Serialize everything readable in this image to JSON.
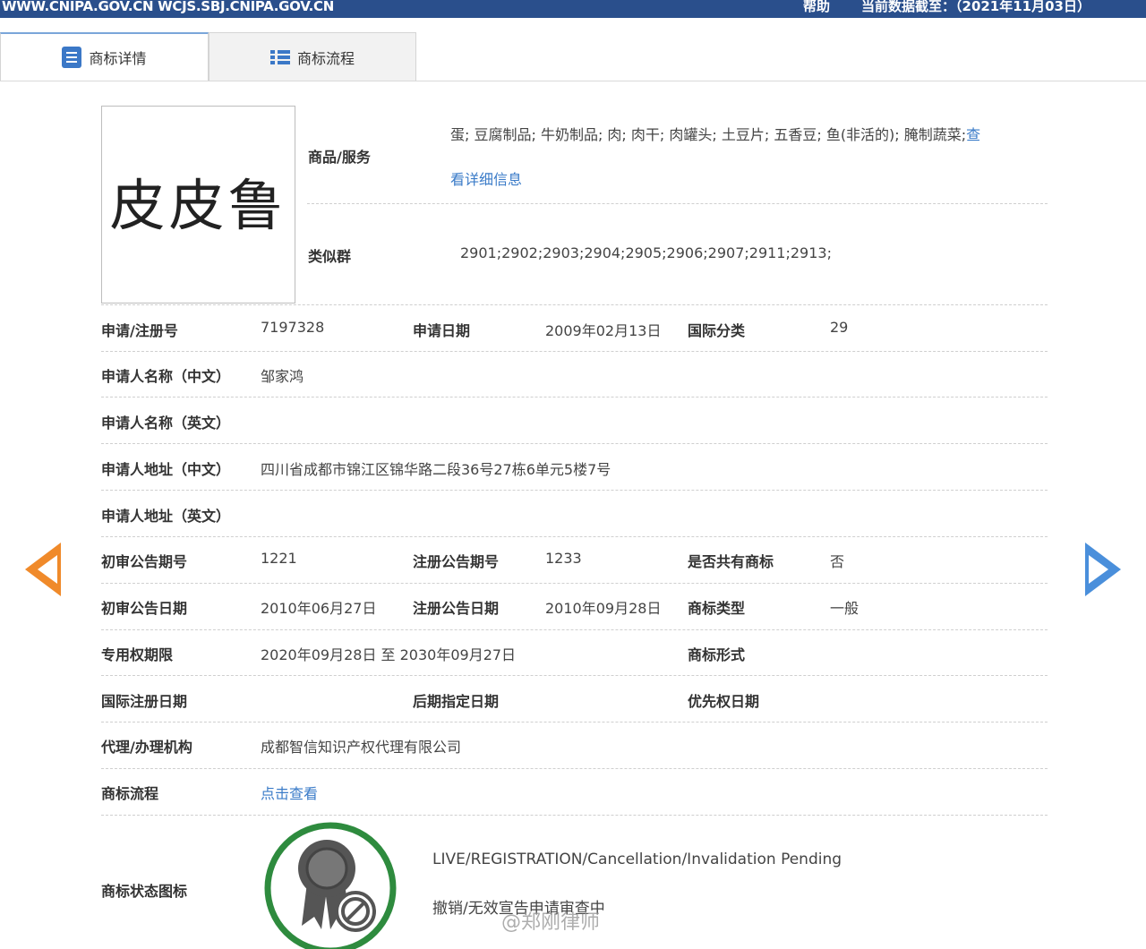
{
  "topbar": {
    "url": "WWW.CNIPA.GOV.CN WCJS.SBJ.CNIPA.GOV.CN",
    "help": "帮助",
    "date": "当前数据截至：（2021年11月03日）"
  },
  "tabs": [
    {
      "label": "商标详情",
      "icon": "document-icon"
    },
    {
      "label": "商标流程",
      "icon": "list-icon"
    }
  ],
  "trademark": {
    "name": "皮皮鲁",
    "goods_label": "商品/服务",
    "goods_value": "蛋; 豆腐制品; 牛奶制品; 肉; 肉干; 肉罐头; 土豆片; 五香豆; 鱼(非活的); 腌制蔬菜;",
    "goods_more": "查",
    "goods_more_2": "看详细信息",
    "similar_label": "类似群",
    "similar_value": "2901;2902;2903;2904;2905;2906;2907;2911;2913;"
  },
  "fields": {
    "reg_no_label": "申请/注册号",
    "reg_no": "7197328",
    "app_date_label": "申请日期",
    "app_date": "2009年02月13日",
    "intl_class_label": "国际分类",
    "intl_class": "29",
    "applicant_cn_label": "申请人名称（中文）",
    "applicant_cn": "邹家鸿",
    "applicant_en_label": "申请人名称（英文）",
    "address_cn_label": "申请人地址（中文）",
    "address_cn": "四川省成都市锦江区锦华路二段36号27栋6单元5楼7号",
    "address_en_label": "申请人地址（英文）",
    "prelim_no_label": "初审公告期号",
    "prelim_no": "1221",
    "reg_ann_no_label": "注册公告期号",
    "reg_ann_no": "1233",
    "shared_label": "是否共有商标",
    "shared": "否",
    "prelim_date_label": "初审公告日期",
    "prelim_date": "2010年06月27日",
    "reg_ann_date_label": "注册公告日期",
    "reg_ann_date": "2010年09月28日",
    "tm_type_label": "商标类型",
    "tm_type": "一般",
    "exclusive_label": "专用权期限",
    "exclusive": "2020年09月28日 至 2030年09月27日",
    "tm_form_label": "商标形式",
    "intl_reg_date_label": "国际注册日期",
    "later_date_label": "后期指定日期",
    "priority_label": "优先权日期",
    "agency_label": "代理/办理机构",
    "agency": "成都智信知识产权代理有限公司",
    "process_label": "商标流程",
    "process_link": "点击查看",
    "status_label": "商标状态图标",
    "status_en": "LIVE/REGISTRATION/Cancellation/Invalidation Pending",
    "status_cn": "撤销/无效宣告申请审查中"
  },
  "watermark": "@郑刚律师",
  "colors": {
    "topbar": "#2a4f8c",
    "link": "#3a7bc8",
    "left_arrow": "#f08a2a",
    "right_arrow": "#4a8fdb",
    "status_ring": "#2e8b3e"
  }
}
